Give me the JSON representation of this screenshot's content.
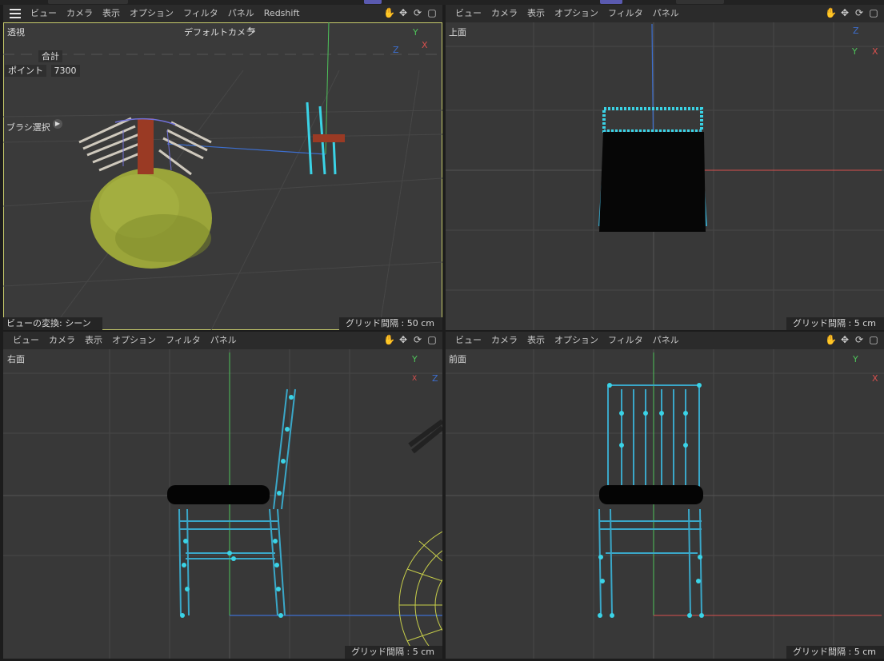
{
  "top_menu": {
    "main": [
      "ビュー",
      "カメラ",
      "表示",
      "オプション",
      "フィルタ",
      "パネル",
      "Redshift"
    ],
    "secondary": [
      "ビュー",
      "カメラ",
      "表示",
      "オプション",
      "フィルタ",
      "パネル"
    ]
  },
  "viewports": {
    "perspective": {
      "name": "透視",
      "camera": "デフォルトカメラ",
      "hud_total_label": "合計",
      "hud_points_label": "ポイント",
      "hud_points_value": "7300",
      "brush_select": "ブラシ選択",
      "view_transform": "ビューの変換: シーン",
      "grid_spacing": "グリッド間隔 : 50 cm"
    },
    "top": {
      "name": "上面",
      "grid_spacing": "グリッド間隔 : 5 cm"
    },
    "right": {
      "name": "右面",
      "grid_spacing": "グリッド間隔 : 5 cm"
    },
    "front": {
      "name": "前面",
      "grid_spacing": "グリッド間隔 : 5 cm"
    }
  },
  "axis_labels": {
    "x": "X",
    "y": "Y",
    "z": "Z"
  },
  "colors": {
    "viewport_bg": "#383838",
    "grid": "#4a4a4a",
    "mesh_points": "#3ad3e6",
    "mesh_edges": "#3aa7c8",
    "axis_x": "#d8504e",
    "axis_y": "#4ec25a",
    "axis_z": "#3d6fd0",
    "active_border": "#c7cb6b",
    "sphere": "#9ba53a",
    "wireframe_yellow": "#c8cf4a"
  },
  "icons": [
    "hand-icon",
    "move-icon",
    "rotate-icon",
    "maximize-icon",
    "camera-switch-icon",
    "play-icon"
  ]
}
